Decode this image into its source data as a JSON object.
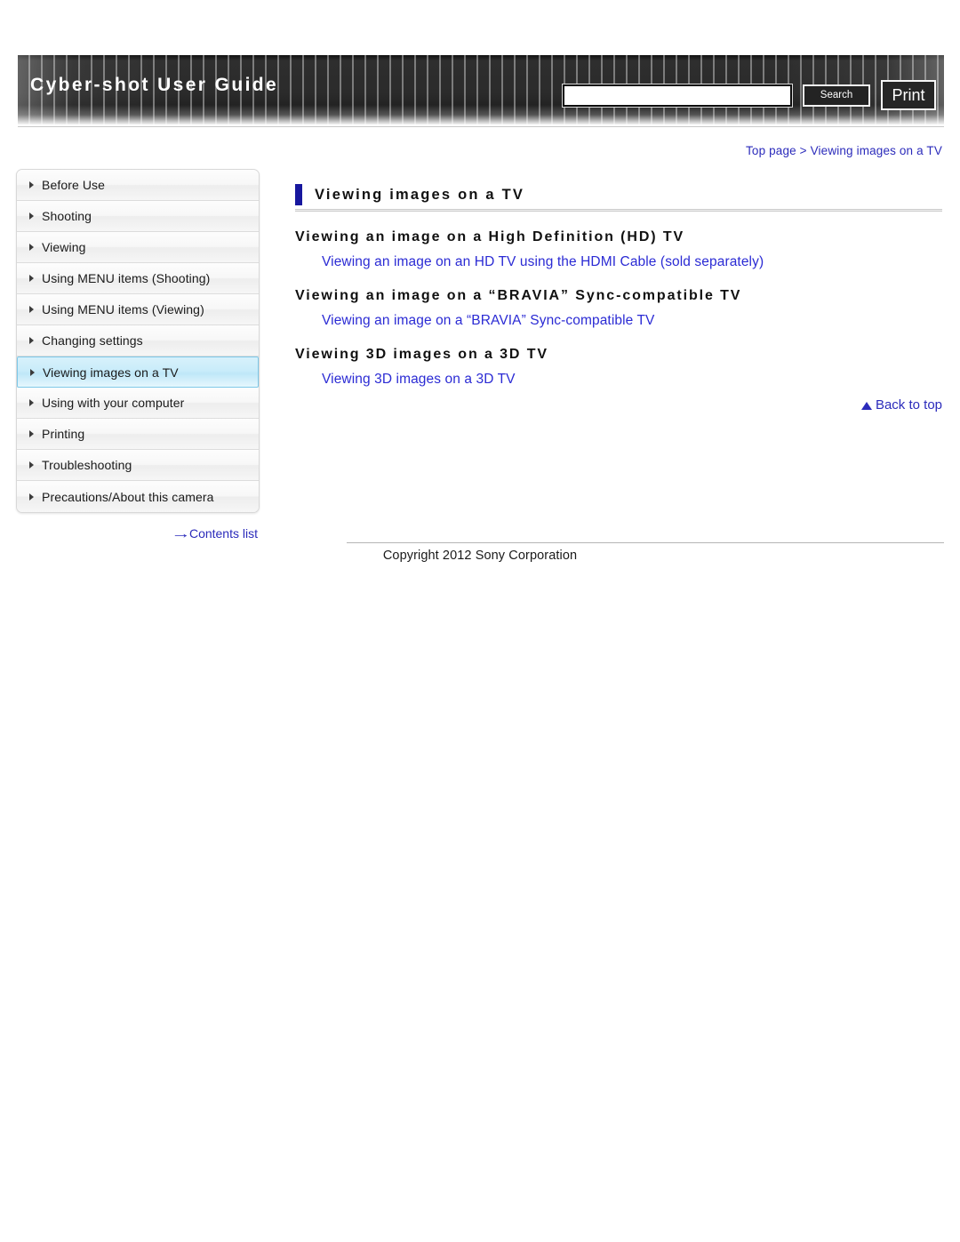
{
  "header": {
    "site_title": "Cyber-shot User Guide",
    "search": {
      "value": "",
      "placeholder": "",
      "button_label": "Search"
    },
    "print_label": "Print"
  },
  "breadcrumb": {
    "text": "Top page > Viewing images on a TV"
  },
  "sidebar": {
    "items": [
      {
        "label": "Before Use",
        "selected": false
      },
      {
        "label": "Shooting",
        "selected": false
      },
      {
        "label": "Viewing",
        "selected": false
      },
      {
        "label": "Using MENU items (Shooting)",
        "selected": false
      },
      {
        "label": "Using MENU items (Viewing)",
        "selected": false
      },
      {
        "label": "Changing settings",
        "selected": false
      },
      {
        "label": "Viewing images on a TV",
        "selected": true
      },
      {
        "label": "Using with your computer",
        "selected": false
      },
      {
        "label": "Printing",
        "selected": false
      },
      {
        "label": "Troubleshooting",
        "selected": false
      },
      {
        "label": "Precautions/About this camera",
        "selected": false
      }
    ],
    "contents_list_label": "Contents list",
    "contents_list_arrow": "→"
  },
  "main": {
    "page_title": "Viewing images on a TV",
    "sections": [
      {
        "heading": "Viewing an image on a High Definition (HD) TV",
        "link": "Viewing an image on an HD TV using the HDMI Cable (sold separately)"
      },
      {
        "heading": "Viewing an image on a “BRAVIA” Sync-compatible TV",
        "link": "Viewing an image on a “BRAVIA” Sync-compatible TV"
      },
      {
        "heading": "Viewing 3D images on a 3D TV",
        "link": "Viewing 3D images on a 3D TV"
      }
    ],
    "back_to_top_label": "Back to top"
  },
  "footer": {
    "copyright": "Copyright 2012 Sony Corporation"
  },
  "colors": {
    "link": "#2b2bd4",
    "breadcrumb": "#2b2bbb",
    "title_marker": "#17179e",
    "selected_item": "#c9ecfa",
    "header_dark": "#2b2b2b"
  }
}
